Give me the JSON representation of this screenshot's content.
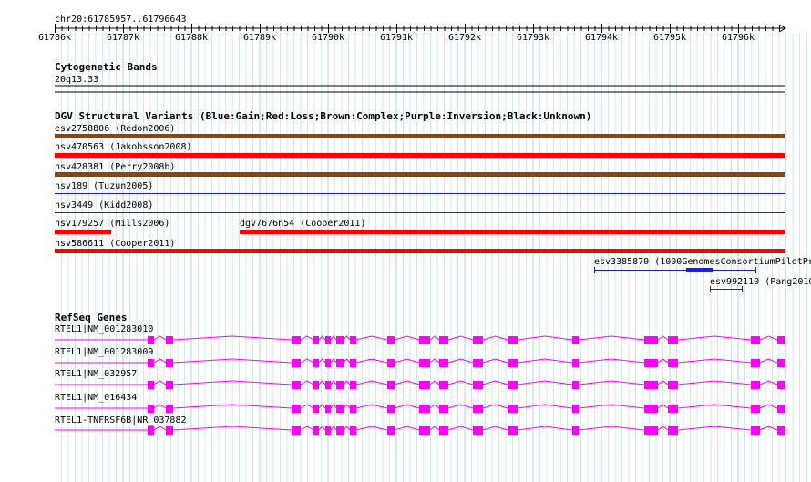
{
  "ruler": {
    "locus": "chr20:61785957..61796643",
    "ticks": [
      "61786k",
      "61787k",
      "61788k",
      "61789k",
      "61790k",
      "61791k",
      "61792k",
      "61793k",
      "61794k",
      "61795k",
      "61796k"
    ]
  },
  "cytoband": {
    "title": "Cytogenetic Bands",
    "band": "20q13.33"
  },
  "dgv": {
    "title": "DGV Structural Variants (Blue:Gain;Red:Loss;Brown:Complex;Purple:Inversion;Black:Unknown)",
    "colors": {
      "gain": "#1a23c8",
      "loss": "#ff0000",
      "complex": "#8b4513",
      "unknown": "#000000"
    },
    "features": [
      {
        "label": "esv2758806 (Redon2006)",
        "type": "complex"
      },
      {
        "label": "nsv470563 (Jakobsson2008)",
        "type": "loss"
      },
      {
        "label": "nsv428381 (Perry2008b)",
        "type": "complex"
      },
      {
        "label": "nsv189 (Tuzun2005)",
        "type": "gain"
      },
      {
        "label": "nsv3449 (Kidd2008)",
        "type": "gain"
      },
      {
        "label": "nsv179257 (Mills2006)",
        "type": "loss"
      },
      {
        "label": "dgv7676n54 (Cooper2011)",
        "type": "loss"
      },
      {
        "label": "nsv586611 (Cooper2011)",
        "type": "loss"
      },
      {
        "label": "esv3385870 (1000GenomesConsortiumPilotPr",
        "type": "gain"
      },
      {
        "label": "esv992110 (Pang2010",
        "type": "gain"
      }
    ]
  },
  "refseq": {
    "title": "RefSeq Genes",
    "color": "#ff00ff",
    "genes": [
      {
        "label": "RTEL1|NM_001283010"
      },
      {
        "label": "RTEL1|NM_001283009"
      },
      {
        "label": "RTEL1|NM_032957"
      },
      {
        "label": "RTEL1|NM_016434"
      },
      {
        "label": "RTEL1-TNFRSF6B|NR_037882"
      }
    ]
  }
}
